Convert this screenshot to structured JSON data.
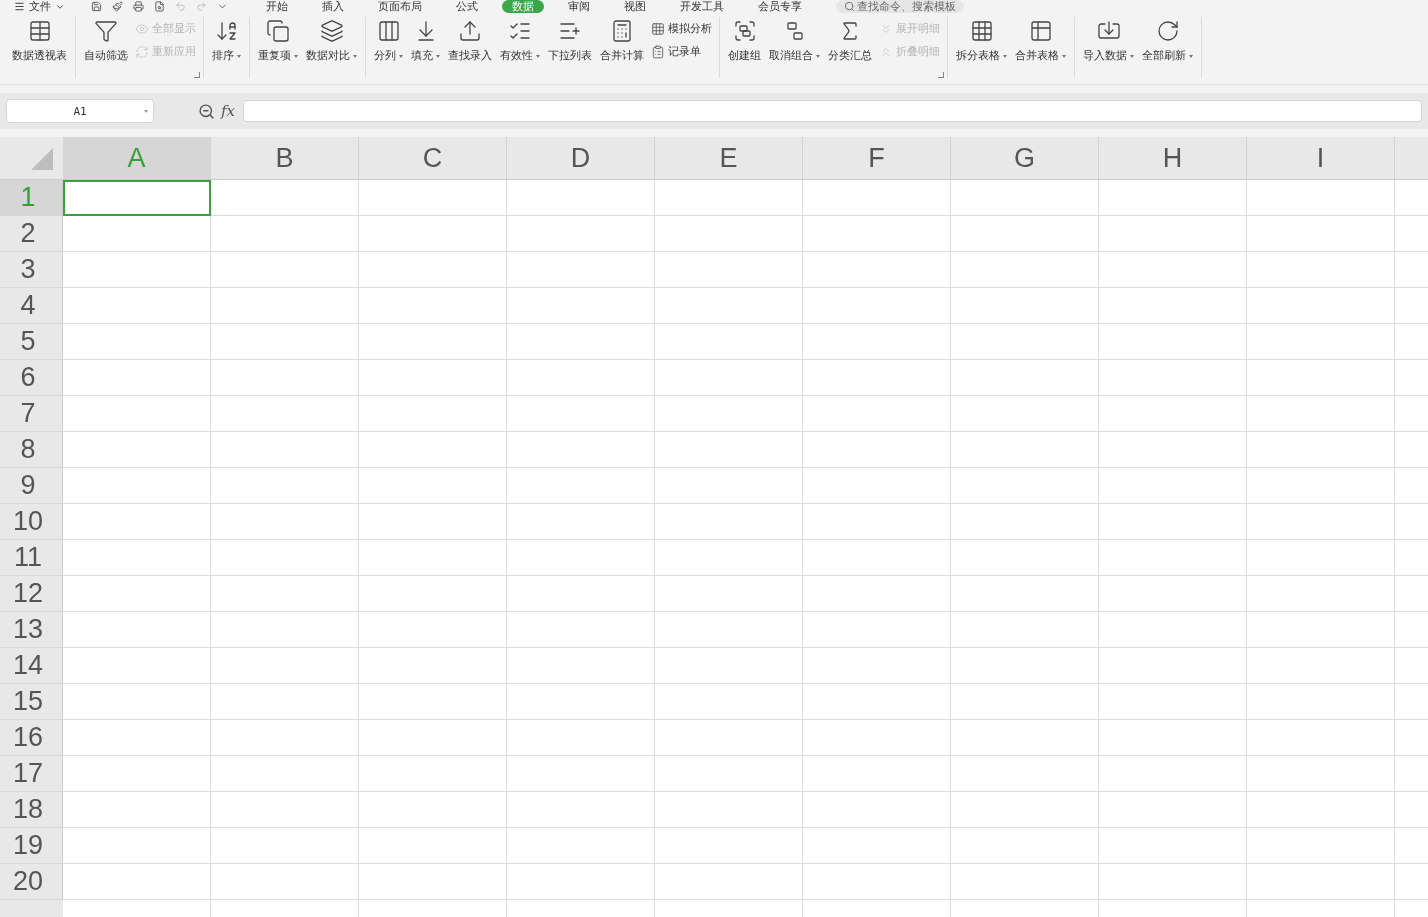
{
  "menu": {
    "label": "文件"
  },
  "tabs": [
    {
      "label": "开始",
      "selected": false
    },
    {
      "label": "插入",
      "selected": false
    },
    {
      "label": "页面布局",
      "selected": false
    },
    {
      "label": "公式",
      "selected": false
    },
    {
      "label": "数据",
      "selected": true
    },
    {
      "label": "审阅",
      "selected": false
    },
    {
      "label": "视图",
      "selected": false
    },
    {
      "label": "开发工具",
      "selected": false
    },
    {
      "label": "会员专享",
      "selected": false
    }
  ],
  "search": {
    "placeholder": "查找命令、搜索模板"
  },
  "ribbon_groups": [
    {
      "launcher": false,
      "items": [
        {
          "kind": "large",
          "label": "数据透视表",
          "dropdown": false,
          "disabled": false
        }
      ]
    },
    {
      "launcher": true,
      "items": [
        {
          "kind": "large",
          "label": "自动筛选",
          "dropdown": false,
          "disabled": false
        },
        {
          "kind": "stack",
          "items": [
            {
              "label": "全部显示",
              "disabled": true
            },
            {
              "label": "重新应用",
              "disabled": true
            }
          ]
        }
      ]
    },
    {
      "launcher": false,
      "items": [
        {
          "kind": "large",
          "label": "排序",
          "dropdown": true,
          "disabled": false
        }
      ]
    },
    {
      "launcher": false,
      "items": [
        {
          "kind": "large",
          "label": "重复项",
          "dropdown": true,
          "disabled": false
        },
        {
          "kind": "large",
          "label": "数据对比",
          "dropdown": true,
          "disabled": false
        }
      ]
    },
    {
      "launcher": false,
      "items": [
        {
          "kind": "large",
          "label": "分列",
          "dropdown": true,
          "disabled": false
        },
        {
          "kind": "large",
          "label": "填充",
          "dropdown": true,
          "disabled": false
        },
        {
          "kind": "large",
          "label": "查找录入",
          "dropdown": false,
          "disabled": false
        },
        {
          "kind": "large",
          "label": "有效性",
          "dropdown": true,
          "disabled": false
        },
        {
          "kind": "large",
          "label": "下拉列表",
          "dropdown": false,
          "disabled": false
        },
        {
          "kind": "large",
          "label": "合并计算",
          "dropdown": false,
          "disabled": false
        },
        {
          "kind": "stack",
          "items": [
            {
              "label": "模拟分析",
              "disabled": false
            },
            {
              "label": "记录单",
              "disabled": false
            }
          ]
        }
      ]
    },
    {
      "launcher": true,
      "items": [
        {
          "kind": "large",
          "label": "创建组",
          "dropdown": false,
          "disabled": false
        },
        {
          "kind": "large",
          "label": "取消组合",
          "dropdown": true,
          "disabled": false
        },
        {
          "kind": "large",
          "label": "分类汇总",
          "dropdown": false,
          "disabled": false
        },
        {
          "kind": "stack",
          "items": [
            {
              "label": "展开明细",
              "disabled": true
            },
            {
              "label": "折叠明细",
              "disabled": true
            }
          ]
        }
      ]
    },
    {
      "launcher": false,
      "items": [
        {
          "kind": "large",
          "label": "拆分表格",
          "dropdown": true,
          "disabled": false
        },
        {
          "kind": "large",
          "label": "合并表格",
          "dropdown": true,
          "disabled": false
        }
      ]
    },
    {
      "launcher": false,
      "items": [
        {
          "kind": "large",
          "label": "导入数据",
          "dropdown": true,
          "disabled": false
        },
        {
          "kind": "large",
          "label": "全部刷新",
          "dropdown": true,
          "disabled": false
        }
      ]
    }
  ],
  "name_box": {
    "value": "A1"
  },
  "formula_bar": {
    "label": "fx"
  },
  "columns": [
    {
      "label": "A",
      "selected": true
    },
    {
      "label": "B",
      "selected": false
    },
    {
      "label": "C",
      "selected": false
    },
    {
      "label": "D",
      "selected": false
    },
    {
      "label": "E",
      "selected": false
    },
    {
      "label": "F",
      "selected": false
    },
    {
      "label": "G",
      "selected": false
    },
    {
      "label": "H",
      "selected": false
    },
    {
      "label": "I",
      "selected": false
    }
  ],
  "rows": [
    {
      "label": "1",
      "selected": true
    },
    {
      "label": "2",
      "selected": false
    },
    {
      "label": "3",
      "selected": false
    },
    {
      "label": "4",
      "selected": false
    },
    {
      "label": "5",
      "selected": false
    },
    {
      "label": "6",
      "selected": false
    },
    {
      "label": "7",
      "selected": false
    },
    {
      "label": "8",
      "selected": false
    },
    {
      "label": "9",
      "selected": false
    },
    {
      "label": "10",
      "selected": false
    },
    {
      "label": "11",
      "selected": false
    },
    {
      "label": "12",
      "selected": false
    },
    {
      "label": "13",
      "selected": false
    },
    {
      "label": "14",
      "selected": false
    },
    {
      "label": "15",
      "selected": false
    },
    {
      "label": "16",
      "selected": false
    },
    {
      "label": "17",
      "selected": false
    },
    {
      "label": "18",
      "selected": false
    },
    {
      "label": "19",
      "selected": false
    },
    {
      "label": "20",
      "selected": false
    }
  ]
}
